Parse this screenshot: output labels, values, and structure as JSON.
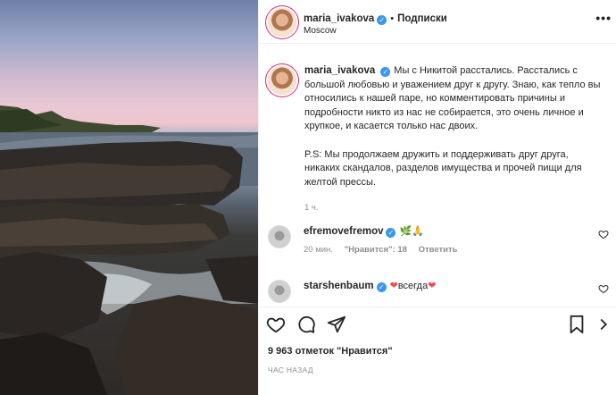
{
  "post": {
    "author": "maria_ivakova",
    "follow_label": "Подписки",
    "location": "Moscow",
    "caption_author": "maria_ivakova",
    "caption_text": "Мы с Никитой расстались. Расстались с большой любовью и уважением друг к другу. Знаю, как тепло вы относились к нашей паре, но комментировать причины и подробности никто из нас не собирается, это очень личное и хрупкое, и касается только нас двоих.",
    "caption_ps": "P.S: Мы продолжаем дружить и поддерживать друг друга, никаких скандалов, разделов имущества и прочей пищи для желтой прессы.",
    "caption_time": "1 ч."
  },
  "comments": [
    {
      "username": "efremovefremov",
      "text": "🌿🙏",
      "time": "20 мин.",
      "likes": "\"Нравится\": 18",
      "reply": "Ответить"
    },
    {
      "username": "starshenbaum",
      "text": "всегда",
      "heart_color": "#ed4956"
    }
  ],
  "footer": {
    "likes": "9 963 отметок \"Нравится\"",
    "posted": "ЧАС НАЗАД"
  },
  "icons": {
    "more": "more-options-icon",
    "like": "heart-icon",
    "comment": "comment-icon",
    "share": "share-icon",
    "save": "bookmark-icon"
  },
  "colors": {
    "verified": "#3897f0",
    "muted": "#8e8e8e",
    "text": "#262626"
  }
}
